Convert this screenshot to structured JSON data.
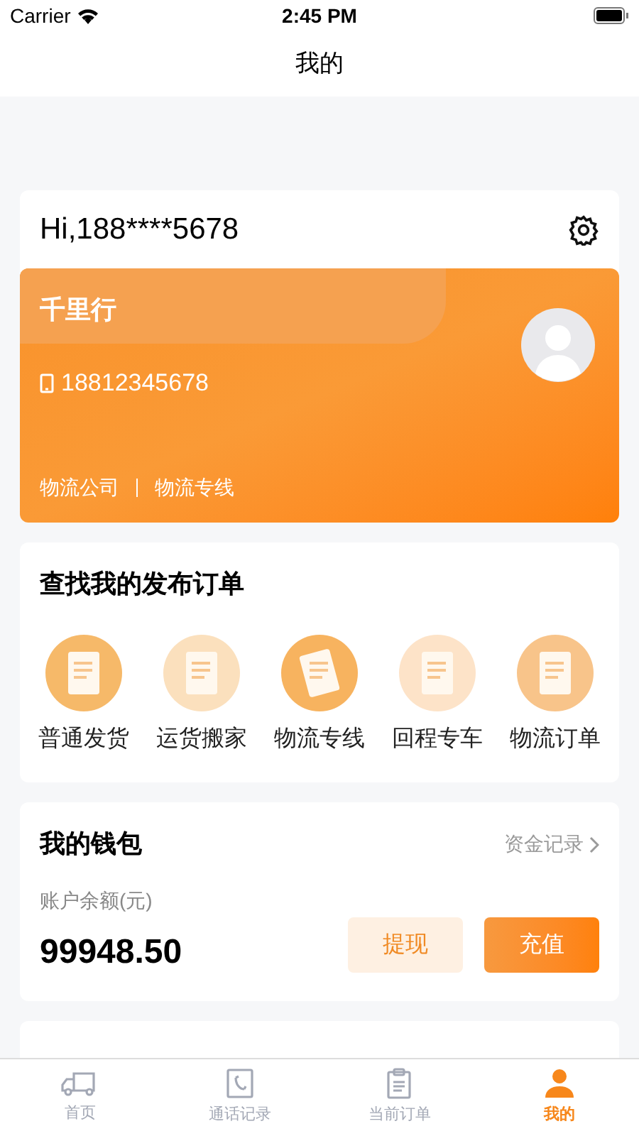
{
  "status_bar": {
    "carrier": "Carrier",
    "time": "2:45 PM"
  },
  "nav": {
    "title": "我的"
  },
  "profile": {
    "greeting": "Hi,188****5678",
    "name": "千里行",
    "phone": "18812345678",
    "tags": [
      "物流公司",
      "物流专线"
    ]
  },
  "orders": {
    "title": "查找我的发布订单",
    "items": [
      {
        "label": "普通发货"
      },
      {
        "label": "运货搬家"
      },
      {
        "label": "物流专线"
      },
      {
        "label": "回程专车"
      },
      {
        "label": "物流订单"
      }
    ]
  },
  "wallet": {
    "title": "我的钱包",
    "link": "资金记录",
    "balance_label": "账户余额(元)",
    "balance": "99948.50",
    "buttons": [
      {
        "label": "提现",
        "kind": "secondary"
      },
      {
        "label": "充值",
        "kind": "primary"
      }
    ]
  },
  "tab_bar": [
    {
      "label": "首页",
      "kind": "truck",
      "selected": false
    },
    {
      "label": "通话记录",
      "kind": "call",
      "selected": false
    },
    {
      "label": "当前订单",
      "kind": "clipboard",
      "selected": false
    },
    {
      "label": "我的",
      "kind": "person",
      "selected": true
    }
  ]
}
